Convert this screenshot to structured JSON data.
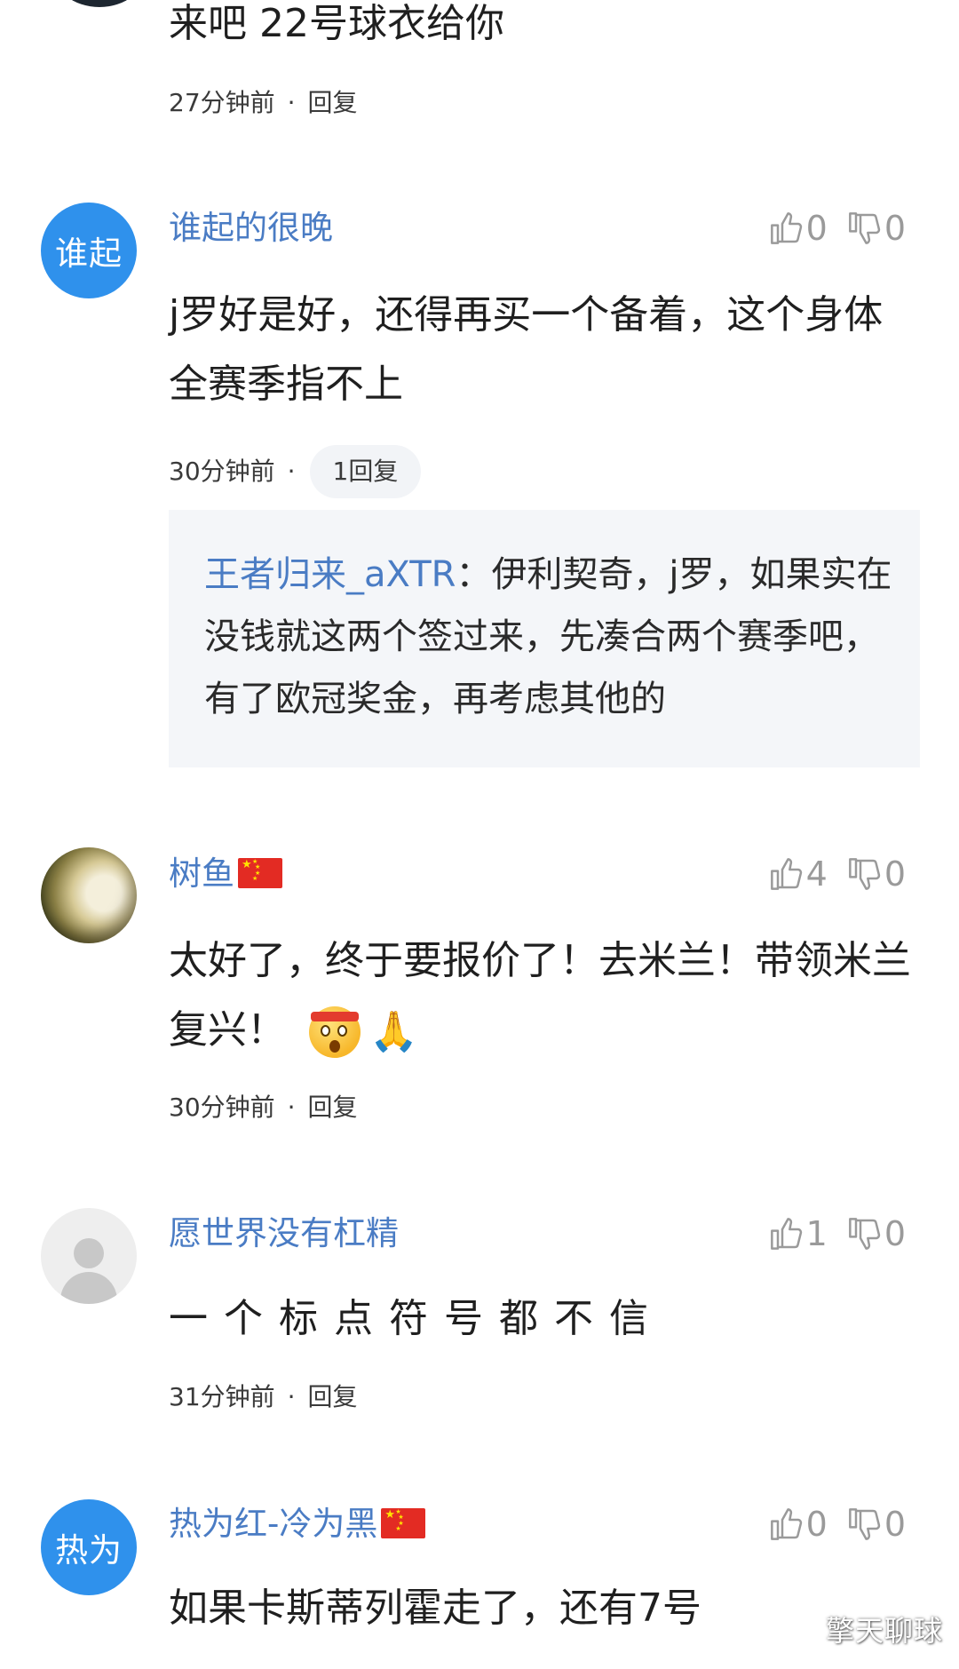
{
  "top_comment": {
    "text": "来吧 22号球衣给你",
    "time": "27分钟前",
    "reply_label": "回复"
  },
  "comments": [
    {
      "avatar_text": "谁起",
      "username": "谁起的很晚",
      "likes": "0",
      "dislikes": "0",
      "text": "j罗好是好，还得再买一个备着，这个身体全赛季指不上",
      "time": "30分钟前",
      "reply_label": "1回复",
      "sub_reply": {
        "name": "王者归来_aXTR",
        "separator": "：",
        "text": "伊利契奇，j罗，如果实在没钱就这两个签过来，先凑合两个赛季吧，有了欧冠奖金，再考虑其他的"
      }
    },
    {
      "avatar_icon": "moon-avatar",
      "username": "树鱼",
      "likes": "4",
      "dislikes": "0",
      "text": "太好了，终于要报价了！去米兰！带领米兰复兴！",
      "time": "30分钟前",
      "reply_label": "回复"
    },
    {
      "avatar_icon": "default-user-avatar",
      "username": "愿世界没有杠精",
      "likes": "1",
      "dislikes": "0",
      "text": "一个标点符号都不信",
      "time": "31分钟前",
      "reply_label": "回复"
    },
    {
      "avatar_text": "热为",
      "username": "热为红-冷为黑",
      "likes": "0",
      "dislikes": "0",
      "text": "如果卡斯蒂列霍走了，还有7号"
    }
  ],
  "dot": "·",
  "watermark": "擎天聊球",
  "colors": {
    "username": "#4a7cc4",
    "avatar_blue": "#2f91ec",
    "icon_gray": "#9a9a9a",
    "sub_reply_bg": "#f4f6f9"
  }
}
